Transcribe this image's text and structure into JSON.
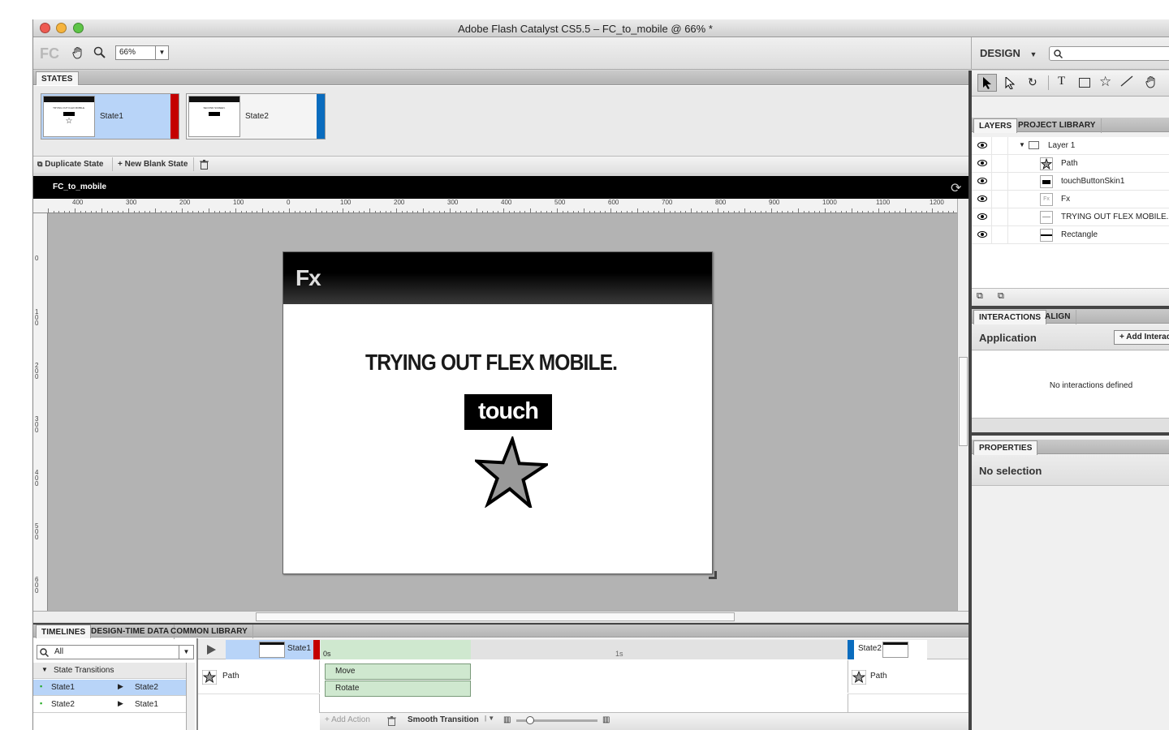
{
  "window": {
    "title": "Adobe Flash Catalyst CS5.5 – FC_to_mobile @ 66% *"
  },
  "toolbar": {
    "logo": "FC",
    "zoom": "66%",
    "workspace": "DESIGN",
    "search_placeholder": ""
  },
  "states_panel": {
    "tab": "STATES",
    "states": [
      {
        "name": "State1",
        "color": "#c40000"
      },
      {
        "name": "State2",
        "color": "#0a6cbe"
      }
    ],
    "duplicate_label": "Duplicate State",
    "new_blank_label": "New Blank State"
  },
  "document": {
    "tab": "FC_to_mobile"
  },
  "ruler": {
    "h_labels": [
      "400",
      "300",
      "200",
      "100",
      "0",
      "100",
      "200",
      "300",
      "400",
      "500",
      "600",
      "700",
      "800",
      "900",
      "1000",
      "1100",
      "1200"
    ],
    "v_labels": [
      "0",
      "1\n0\n0",
      "2\n0\n0",
      "3\n0\n0",
      "4\n0\n0",
      "5\n0\n0",
      "6\n0\n0"
    ]
  },
  "artboard": {
    "header_text": "Fx",
    "heading": "TRYING OUT FLEX MOBILE.",
    "button_text": "touch"
  },
  "right_panel": {
    "tabs": [
      "LAYERS",
      "PROJECT LIBRARY"
    ],
    "layers": [
      {
        "name": "Layer 1"
      },
      {
        "name": "Path"
      },
      {
        "name": "touchButtonSkin1"
      },
      {
        "name": "Fx"
      },
      {
        "name": "TRYING OUT FLEX MOBILE."
      },
      {
        "name": "Rectangle"
      }
    ],
    "interactions_tabs": [
      "INTERACTIONS",
      "ALIGN"
    ],
    "interactions_target": "Application",
    "add_interaction": "Add Interac",
    "no_interactions": "No interactions defined",
    "properties_tab": "PROPERTIES",
    "properties_text": "No selection"
  },
  "bottom": {
    "tabs": [
      "TIMELINES",
      "DESIGN-TIME DATA",
      "COMMON LIBRARY"
    ],
    "filter": "All",
    "transitions_label": "State Transitions",
    "transitions": [
      {
        "from": "State1",
        "to": "State2"
      },
      {
        "from": "State2",
        "to": "State1"
      }
    ],
    "start_state": "State1",
    "end_state": "State2",
    "time_0": "0s",
    "time_1": "1s",
    "left_track": "Path",
    "right_track": "Path",
    "actions": [
      "Move",
      "Rotate"
    ],
    "add_action": "Add Action",
    "smooth": "Smooth Transition"
  }
}
